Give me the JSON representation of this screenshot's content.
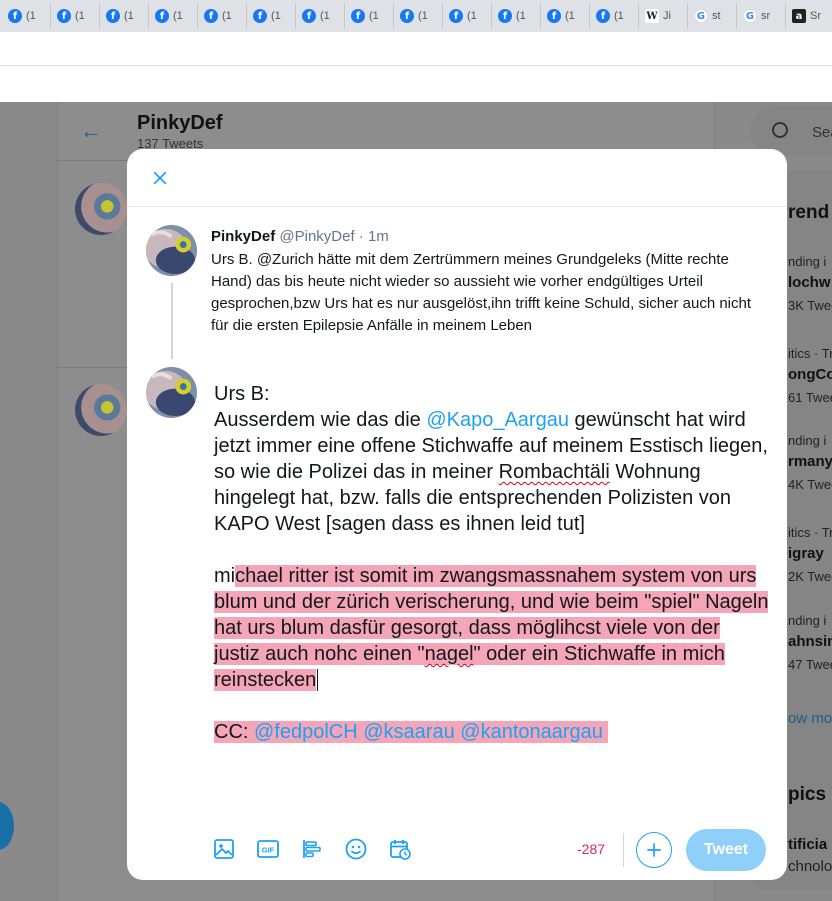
{
  "browser": {
    "tabs": [
      {
        "icon": "facebook-icon",
        "label": "(1"
      },
      {
        "icon": "facebook-icon",
        "label": "(1"
      },
      {
        "icon": "facebook-icon",
        "label": "(1"
      },
      {
        "icon": "facebook-icon",
        "label": "(1"
      },
      {
        "icon": "facebook-icon",
        "label": "(1"
      },
      {
        "icon": "facebook-icon",
        "label": "(1"
      },
      {
        "icon": "facebook-icon",
        "label": "(1"
      },
      {
        "icon": "facebook-icon",
        "label": "(1"
      },
      {
        "icon": "facebook-icon",
        "label": "(1"
      },
      {
        "icon": "facebook-icon",
        "label": "(1"
      },
      {
        "icon": "facebook-icon",
        "label": "(1"
      },
      {
        "icon": "facebook-icon",
        "label": "(1"
      },
      {
        "icon": "facebook-icon",
        "label": "(1"
      },
      {
        "icon": "wikipedia-icon",
        "label": "Ji"
      },
      {
        "icon": "google-icon",
        "label": "st"
      },
      {
        "icon": "google-icon",
        "label": "sr"
      },
      {
        "icon": "amazon-icon",
        "label": "Sr"
      }
    ]
  },
  "background": {
    "profile_name": "PinkyDef",
    "tweet_count": "137 Tweets",
    "search_placeholder": "Sea",
    "trends_title": "rend",
    "trends": [
      {
        "context": "nding i",
        "name": "lochw",
        "count": "3K Twee"
      },
      {
        "context": "itics · Tr",
        "name": "ongCo",
        "count": "61 Twee"
      },
      {
        "context": "nding i",
        "name": "rmany",
        "count": "4K Twee"
      },
      {
        "context": "itics · Tr",
        "name": "igray",
        "count": "2K Twee"
      },
      {
        "context": "nding i",
        "name": "ahnsin",
        "count": "47 Twee"
      }
    ],
    "show_more": "ow mo",
    "topics_title": "pics",
    "topic_name": "tificia",
    "topic_sub": "chnolo"
  },
  "modal": {
    "original_tweet": {
      "display_name": "PinkyDef",
      "handle": "@PinkyDef",
      "separator": " · ",
      "time": "1m",
      "text": "Urs B. @Zurich hätte mit dem Zertrümmern meines Grundgeleks (Mitte rechte Hand) das bis heute nicht wieder so aussieht wie vorher endgültiges Urteil gesprochen,bzw Urs hat es nur ausgelöst,ihn trifft keine Schuld, sicher auch nicht für die ersten Epilepsie Anfälle in meinem Leben"
    },
    "reply": {
      "line1": "Urs B:",
      "p2_a": "Ausserdem wie das die ",
      "p2_mention": "@Kapo_Aargau",
      "p2_b": " gewünscht hat wird jetzt immer eine offene Stichwaffe auf meinem Esstisch liegen, so wie die Polizei das in meiner ",
      "p2_spell": "Rombachtäli",
      "p2_c": " Wohnung hingelegt hat, bzw. falls die entsprechenden Polizisten von KAPO West [sagen dass es ihnen leid tut]",
      "p3_pre": "mi",
      "p3_hl_a": "chael ritter ist somit im zwangsmassnahem system von urs blum und der zürich verischerung, und wie beim \"spiel\" Nageln hat urs blum dasfür gesorgt, dass möglihcst viele von der justiz auch nohc einen \"",
      "p3_spell": "nagel",
      "p3_hl_b": "\" oder ein Stichwaffe in mich reinstecken",
      "p4_cc": "CC: ",
      "p4_m1": "@fedpolCH",
      "p4_m2": "@ksaarau",
      "p4_m3": "@kantonaargau"
    },
    "toolbar": {
      "char_counter": "-287",
      "tweet_label": "Tweet"
    }
  }
}
